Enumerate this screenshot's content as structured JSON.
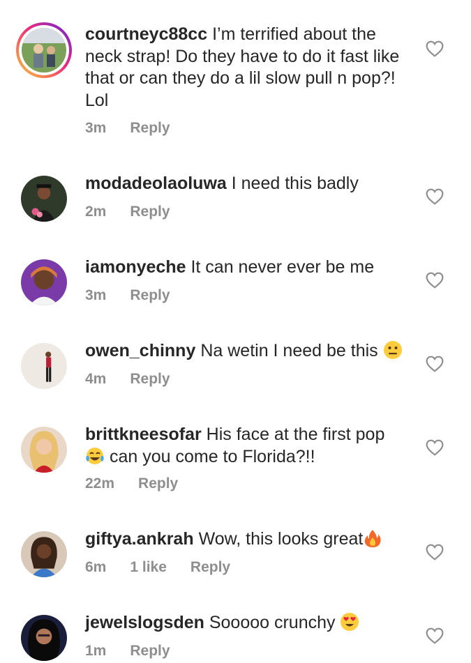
{
  "comments": [
    {
      "username": "courtneyc88cc",
      "text": "I’m terrified about the neck strap! Do they have to do it fast like that or can they do a lil slow pull n pop?! Lol",
      "time": "3m",
      "likes": "",
      "reply": "Reply",
      "has_story": true,
      "avatar_icon": "avatar-photo-children"
    },
    {
      "username": "modadeolaoluwa",
      "text": "I need this badly",
      "time": "2m",
      "likes": "",
      "reply": "Reply",
      "has_story": false,
      "avatar_icon": "avatar-photo-graduate"
    },
    {
      "username": "iamonyeche",
      "text": "It can never ever be me",
      "time": "3m",
      "likes": "",
      "reply": "Reply",
      "has_story": false,
      "avatar_icon": "avatar-photo-woman"
    },
    {
      "username": "owen_chinny",
      "text": "Na wetin I need be this",
      "emoji": "neutral-face-emoji",
      "time": "4m",
      "likes": "",
      "reply": "Reply",
      "has_story": false,
      "avatar_icon": "avatar-photo-standing"
    },
    {
      "username": "brittkneesofar",
      "text": "His face at the first pop",
      "emoji_mid": "tears-of-joy-emoji",
      "text2": "can you come to Florida?!!",
      "time": "22m",
      "likes": "",
      "reply": "Reply",
      "has_story": false,
      "avatar_icon": "avatar-photo-blonde"
    },
    {
      "username": "giftya.ankrah",
      "text": "Wow, this looks great",
      "emoji": "fire-emoji",
      "time": "6m",
      "likes": "1 like",
      "reply": "Reply",
      "has_story": false,
      "avatar_icon": "avatar-photo-woman2"
    },
    {
      "username": "jewelslogsden",
      "text": "Sooooo crunchy",
      "emoji": "heart-eyes-emoji",
      "time": "1m",
      "likes": "",
      "reply": "Reply",
      "has_story": false,
      "avatar_icon": "avatar-photo-selfie"
    }
  ],
  "colors": {
    "text": "#262626",
    "meta": "#8e8e8e",
    "heart": "#8e8e8e"
  }
}
